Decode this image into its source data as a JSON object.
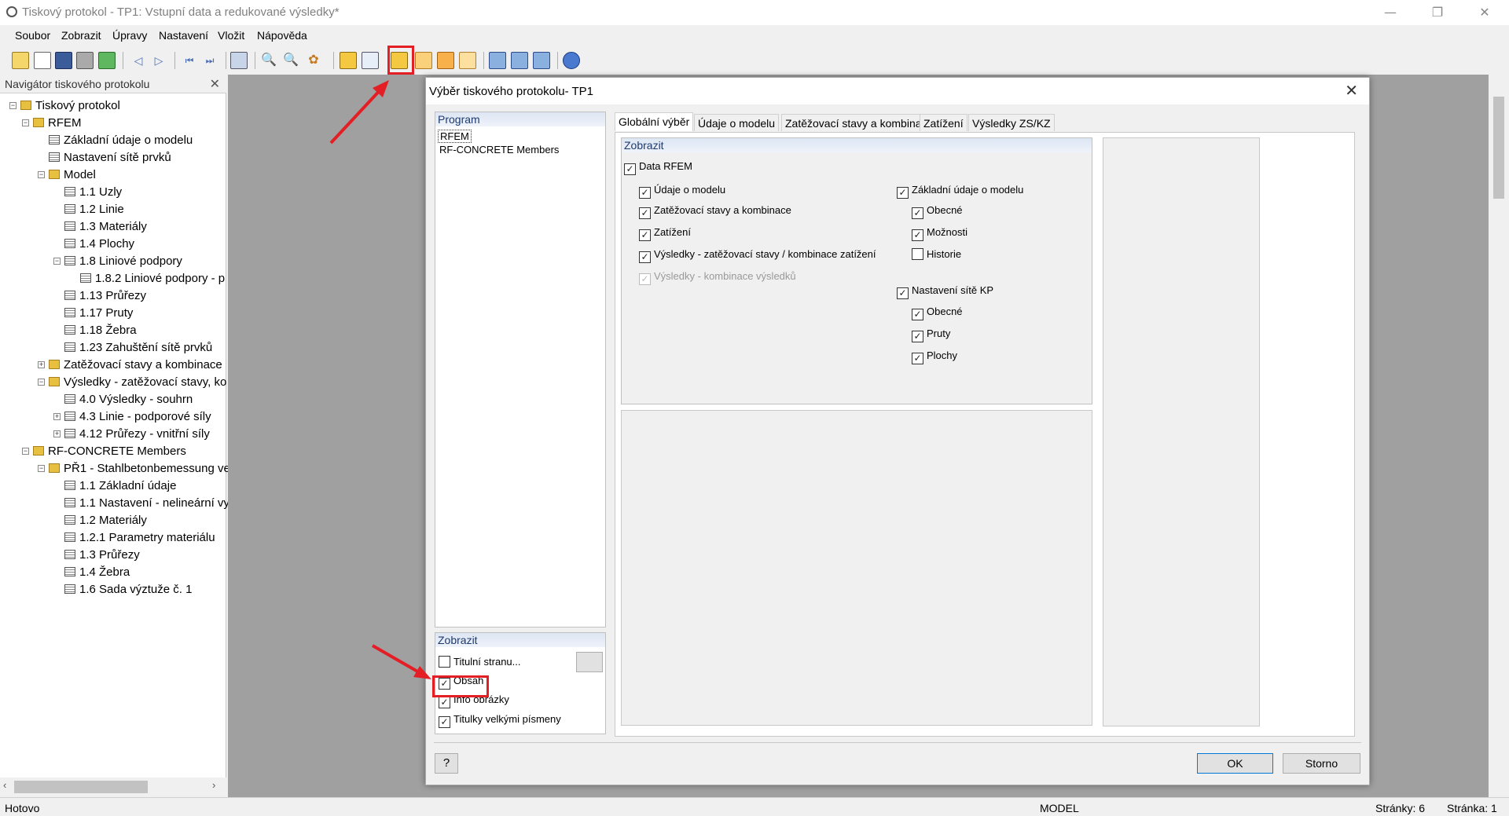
{
  "window": {
    "title": "Tiskový protokol - TP1: Vstupní data a redukované výsledky*"
  },
  "menu": [
    "Soubor",
    "Zobrazit",
    "Úpravy",
    "Nastavení",
    "Vložit",
    "Nápověda"
  ],
  "navigator": {
    "title": "Navigátor tiskového protokolu",
    "items": [
      {
        "label": "Tiskový protokol",
        "icon": "folder-icon"
      },
      {
        "label": "RFEM",
        "icon": "folder-icon"
      },
      {
        "label": "Základní údaje o modelu",
        "icon": "page-icon"
      },
      {
        "label": "Nastavení sítě prvků",
        "icon": "page-icon"
      },
      {
        "label": "Model",
        "icon": "folder-icon"
      },
      {
        "label": "1.1 Uzly",
        "icon": "page-icon"
      },
      {
        "label": "1.2 Linie",
        "icon": "page-icon"
      },
      {
        "label": "1.3 Materiály",
        "icon": "page-icon"
      },
      {
        "label": "1.4 Plochy",
        "icon": "page-icon"
      },
      {
        "label": "1.8 Liniové podpory",
        "icon": "page-icon"
      },
      {
        "label": "1.8.2 Liniové podpory - p",
        "icon": "page-icon"
      },
      {
        "label": "1.13 Průřezy",
        "icon": "page-icon"
      },
      {
        "label": "1.17 Pruty",
        "icon": "page-icon"
      },
      {
        "label": "1.18 Žebra",
        "icon": "page-icon"
      },
      {
        "label": "1.23 Zahuštění sítě prvků",
        "icon": "page-icon"
      },
      {
        "label": "Zatěžovací stavy a kombinace",
        "icon": "folder-icon"
      },
      {
        "label": "Výsledky - zatěžovací stavy, ko",
        "icon": "folder-icon"
      },
      {
        "label": "4.0 Výsledky - souhrn",
        "icon": "page-icon"
      },
      {
        "label": "4.3 Linie - podporové síly",
        "icon": "page-icon"
      },
      {
        "label": "4.12 Průřezy - vnitřní síly",
        "icon": "page-icon"
      },
      {
        "label": "RF-CONCRETE Members",
        "icon": "folder-icon"
      },
      {
        "label": "PŘ1 - Stahlbetonbemessung ve",
        "icon": "folder-icon"
      },
      {
        "label": "1.1 Základní údaje",
        "icon": "page-icon"
      },
      {
        "label": "1.1 Nastavení - nelineární vy",
        "icon": "page-icon"
      },
      {
        "label": "1.2 Materiály",
        "icon": "page-icon"
      },
      {
        "label": "1.2.1 Parametry materiálu",
        "icon": "page-icon"
      },
      {
        "label": "1.3 Průřezy",
        "icon": "page-icon"
      },
      {
        "label": "1.4 Žebra",
        "icon": "page-icon"
      },
      {
        "label": "1.6 Sada výztuže č. 1",
        "icon": "page-icon"
      }
    ]
  },
  "dialog": {
    "title": "Výběr tiskového protokolu- TP1",
    "program_header": "Program",
    "programs": [
      "RFEM",
      "RF-CONCRETE Members"
    ],
    "display_header": "Zobrazit",
    "display_options": [
      {
        "label": "Titulní stranu...",
        "checked": false
      },
      {
        "label": "Obsah",
        "checked": true
      },
      {
        "label": "Info obrázky",
        "checked": true
      },
      {
        "label": "Titulky velkými písmeny",
        "checked": true
      }
    ],
    "tabs": [
      "Globální výběr",
      "Údaje o modelu",
      "Zatěžovací stavy a kombinace",
      "Zatížení",
      "Výsledky ZS/KZ"
    ],
    "show_header": "Zobrazit",
    "data_rfem": "Data RFEM",
    "left_options": [
      {
        "label": "Údaje o modelu",
        "checked": true
      },
      {
        "label": "Zatěžovací stavy a kombinace",
        "checked": true
      },
      {
        "label": "Zatížení",
        "checked": true
      },
      {
        "label": "Výsledky - zatěžovací stavy / kombinace zatížení",
        "checked": true
      },
      {
        "label": "Výsledky - kombinace výsledků",
        "checked": true,
        "disabled": true
      }
    ],
    "right_group1": "Základní údaje o modelu",
    "right_group1_items": [
      {
        "label": "Obecné",
        "checked": true
      },
      {
        "label": "Možnosti",
        "checked": true
      },
      {
        "label": "Historie",
        "checked": false
      }
    ],
    "right_group2": "Nastavení sítě KP",
    "right_group2_items": [
      {
        "label": "Obecné",
        "checked": true
      },
      {
        "label": "Pruty",
        "checked": true
      },
      {
        "label": "Plochy",
        "checked": true
      }
    ],
    "ok": "OK",
    "cancel": "Storno"
  },
  "status": {
    "left": "Hotovo",
    "mode": "MODEL",
    "pages": "Stránky: 6",
    "page": "Stránka: 1"
  }
}
